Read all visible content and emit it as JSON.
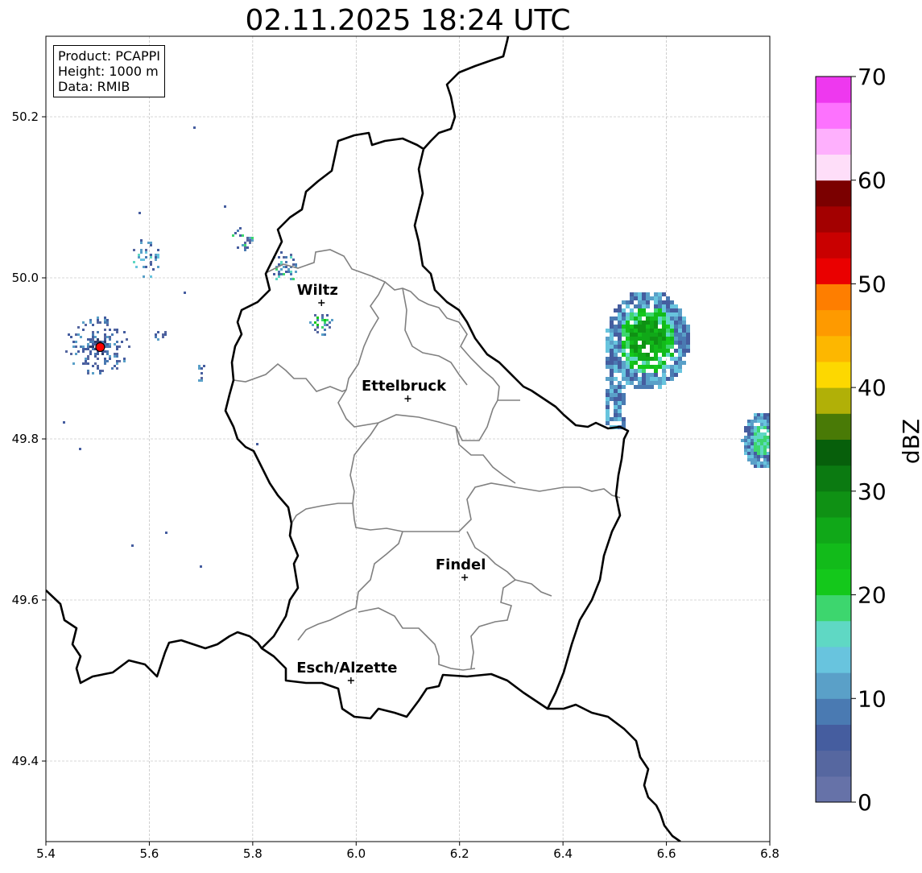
{
  "title": "02.11.2025 18:24 UTC",
  "info": {
    "product": "Product: PCAPPI",
    "height": "Height: 1000 m",
    "data": "Data: RMIB"
  },
  "map": {
    "xlim": [
      5.4,
      6.8
    ],
    "ylim": [
      49.3,
      50.3
    ],
    "xticks": [
      "5.4",
      "5.6",
      "5.8",
      "6.0",
      "6.2",
      "6.4",
      "6.6",
      "6.8"
    ],
    "yticks": [
      "49.4",
      "49.6",
      "49.8",
      "50.0",
      "50.2"
    ],
    "grid": true,
    "cities": [
      {
        "name": "Wiltz",
        "lon": 5.933,
        "lat": 49.969
      },
      {
        "name": "Ettelbruck",
        "lon": 6.1,
        "lat": 49.85
      },
      {
        "name": "Findel",
        "lon": 6.21,
        "lat": 49.628
      },
      {
        "name": "Esch/Alzette",
        "lon": 5.99,
        "lat": 49.5
      }
    ],
    "radar_site": {
      "lon": 5.505,
      "lat": 49.914
    }
  },
  "colorbar": {
    "label": "dBZ",
    "min": 0,
    "max": 70,
    "step": 2.5,
    "ticks": [
      "0",
      "10",
      "20",
      "30",
      "40",
      "50",
      "60",
      "70"
    ],
    "colors": [
      "#6672a8",
      "#5667a0",
      "#455d9f",
      "#4a7ab2",
      "#5aa0c8",
      "#68c4de",
      "#5fd8c4",
      "#3dd66e",
      "#14c81b",
      "#12bb1a",
      "#10a818",
      "#0f9114",
      "#0b7a11",
      "#075f0b",
      "#497a06",
      "#b1b007",
      "#fdd800",
      "#fdb700",
      "#fe9a00",
      "#fe7e00",
      "#ea0000",
      "#c90000",
      "#a30000",
      "#7b0000",
      "#fedef9",
      "#feb0fd",
      "#fd72fe",
      "#ee38ef"
    ]
  },
  "colors": {
    "national_border": "#000000",
    "canton_border": "#808080",
    "grid": "#b0b0b0"
  }
}
